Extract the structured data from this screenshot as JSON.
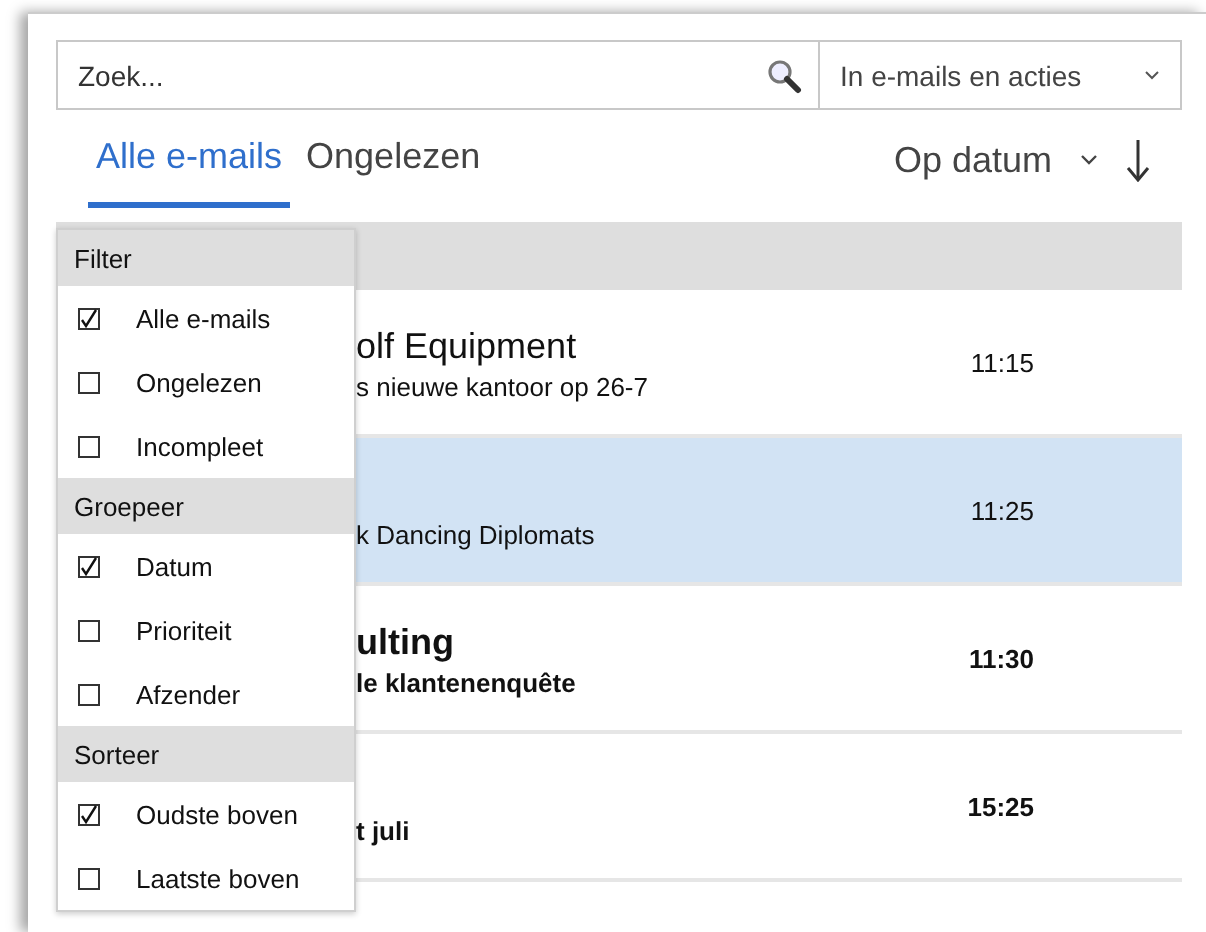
{
  "search": {
    "placeholder": "Zoek...",
    "scope": "In e-mails en acties"
  },
  "tabs": [
    {
      "label": "Alle e-mails",
      "selected": true
    },
    {
      "label": "Ongelezen",
      "selected": false
    }
  ],
  "sort": {
    "label": "Op datum"
  },
  "messages": [
    {
      "sender": "olf Equipment",
      "subject": "s nieuwe kantoor op 26-7",
      "time": "11:15",
      "unread": false,
      "selected": false
    },
    {
      "subject": "k Dancing Diplomats",
      "time": "11:25",
      "unread": false,
      "selected": true
    },
    {
      "sender": "ulting",
      "subject": "le klantenenquête",
      "time": "11:30",
      "unread": true,
      "selected": false
    },
    {
      "subject": "t juli",
      "time": "15:25",
      "unread": true,
      "selected": false
    }
  ],
  "menu": {
    "sections": [
      {
        "title": "Filter",
        "items": [
          {
            "label": "Alle e-mails",
            "checked": true
          },
          {
            "label": "Ongelezen",
            "checked": false
          },
          {
            "label": "Incompleet",
            "checked": false
          }
        ]
      },
      {
        "title": "Groepeer",
        "items": [
          {
            "label": "Datum",
            "checked": true
          },
          {
            "label": "Prioriteit",
            "checked": false
          },
          {
            "label": "Afzender",
            "checked": false
          }
        ]
      },
      {
        "title": "Sorteer",
        "items": [
          {
            "label": "Oudste boven",
            "checked": true
          },
          {
            "label": "Laatste boven",
            "checked": false
          }
        ]
      }
    ]
  }
}
